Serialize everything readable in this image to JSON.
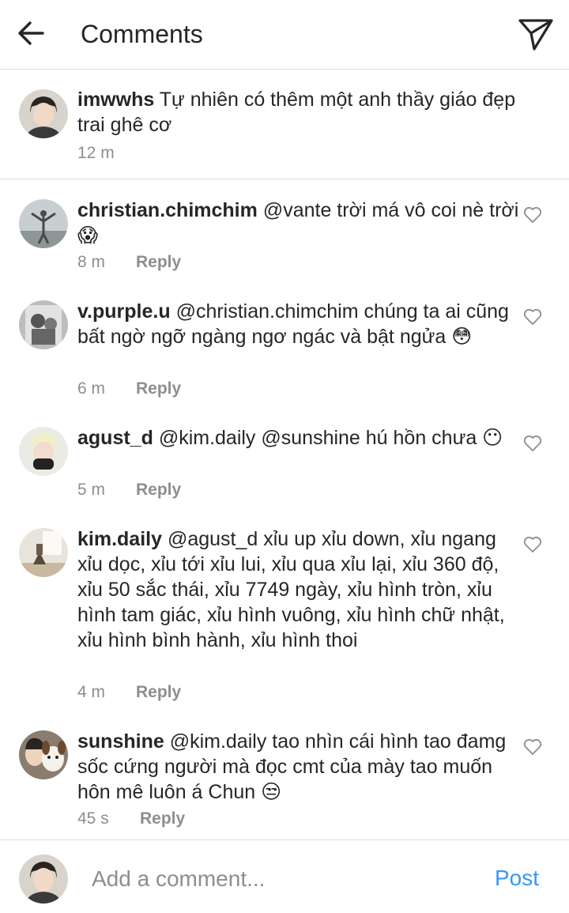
{
  "header": {
    "title": "Comments"
  },
  "caption": {
    "username": "imwwhs",
    "text": "Tự nhiên có thêm một anh thầy giáo đẹp trai ghê cơ",
    "time": "12 m"
  },
  "comments": [
    {
      "username": "christian.chimchim",
      "text": "@vante trời má vô coi nè trời 😱",
      "time": "8 m",
      "reply": "Reply"
    },
    {
      "username": "v.purple.u",
      "text": "@christian.chimchim chúng ta ai cũng bất ngờ ngỡ ngàng ngơ ngác và bật ngửa 😳",
      "time": "6 m",
      "reply": "Reply"
    },
    {
      "username": "agust_d",
      "text": "@kim.daily @sunshine hú hồn chưa 😶",
      "time": "5 m",
      "reply": "Reply"
    },
    {
      "username": "kim.daily",
      "text": "@agust_d xỉu up xỉu down, xỉu ngang xỉu dọc, xỉu tới xỉu lui, xỉu qua xỉu lại, xỉu 360 độ, xỉu 50 sắc thái, xỉu 7749 ngày, xỉu hình tròn, xỉu hình tam giác, xỉu hình vuông, xỉu hình chữ nhật, xỉu hình bình hành, xỉu hình thoi",
      "time": "4 m",
      "reply": "Reply"
    },
    {
      "username": "sunshine",
      "text": "@kim.daily tao nhìn cái hình tao đamg sốc cứng người mà đọc cmt của mày tao muốn hôn mê luôn á Chun 😒",
      "time": "45 s",
      "reply": "Reply"
    }
  ],
  "footer": {
    "placeholder": "Add a comment...",
    "post_label": "Post"
  },
  "colors": {
    "accent": "#3897f0",
    "muted": "#8e8e8e",
    "text": "#262626",
    "divider": "#dbdbdb"
  },
  "icons": {
    "back": "arrow-left-icon",
    "send": "paper-plane-icon",
    "like": "heart-outline-icon"
  }
}
